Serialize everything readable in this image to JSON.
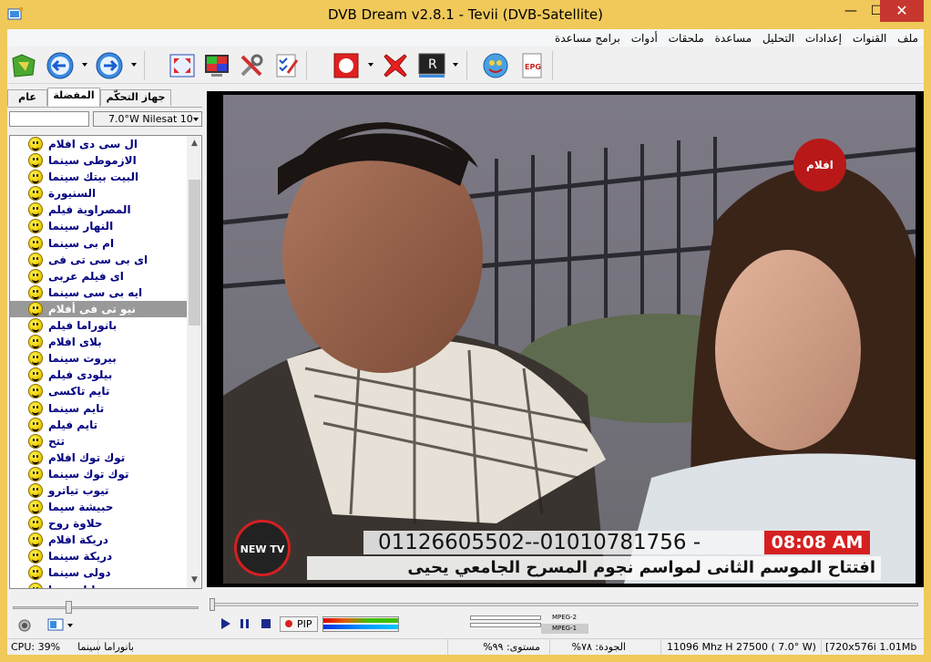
{
  "window": {
    "title": "DVB Dream v2.8.1 - Tevii (DVB-Satellite)",
    "minimize": "—",
    "maximize": "☐",
    "close": "✕"
  },
  "menu": [
    "ملف",
    "القنوات",
    "إعدادات",
    "التحليل",
    "مساعدة",
    "ملحقات",
    "أدوات",
    "برامج مساعدة"
  ],
  "toolbar": {
    "icons": [
      "scan-icon",
      "back-icon",
      "forward-icon",
      "fullscreen-icon",
      "color-icon",
      "tools-icon",
      "checklist-icon",
      "record-icon",
      "delete-icon",
      "rec-display-icon",
      "satellite-icon",
      "epg-icon"
    ],
    "epg_label": "EPG",
    "r_label": "R"
  },
  "tabs": [
    "عام",
    "المفضلة",
    "جهاز التحكّم"
  ],
  "satellite": "7.0°W Nilesat 10",
  "channels": [
    "ال سى دى افلام",
    "الازموطى سينما",
    "البيت بيتك سينما",
    "السنيورة",
    "المصراوية فيلم",
    "النهار سينما",
    "ام بى سينما",
    "اى بى سى تى فى",
    "اى فيلم عربى",
    "ايه بى سى سينما",
    "نيو تى فى أفلام",
    "بانوراما فيلم",
    "بلاى افلام",
    "بيروت سينما",
    "بيلودى فيلم",
    "تايم تاكسى",
    "تايم سينما",
    "تايم فيلم",
    "تتح",
    "توك توك افلام",
    "توك توك سينما",
    "تيوب تياترو",
    "حبيشة سيما",
    "حلاوة روح",
    "دريكة افلام",
    "دريكة سينما",
    "دولى سينما",
    "دوتانا سينما"
  ],
  "selected_index": 10,
  "video": {
    "logo_top": "افلام",
    "logo_bottom": "NEW TV",
    "ticker_numbers": "01126605502--01010781756 -",
    "ticker_time": "08:08 AM",
    "ticker_text": "افتتاح الموسم الثانى لمواسم نجوم المسرح الجامعي يحيى"
  },
  "player": {
    "pip_label": "PIP",
    "mpeg2_label": "MPEG-2",
    "mpeg1_label": "MPEG-1"
  },
  "status": {
    "cpu": "CPU: 39%",
    "channel": "بانوراما سينما",
    "level": "مستوى: ٩٩%",
    "quality": "الجودة: ٧٨%",
    "freq": "11096 Mhz  H  27500  ( 7.0° W)",
    "video": "[720x576i  1.01Mb"
  },
  "colors": {
    "frame": "#f0c95a",
    "close": "#c7372f",
    "selected_row": "#999999",
    "channel_text": "#000080",
    "ticker_time_bg": "#d62020"
  }
}
